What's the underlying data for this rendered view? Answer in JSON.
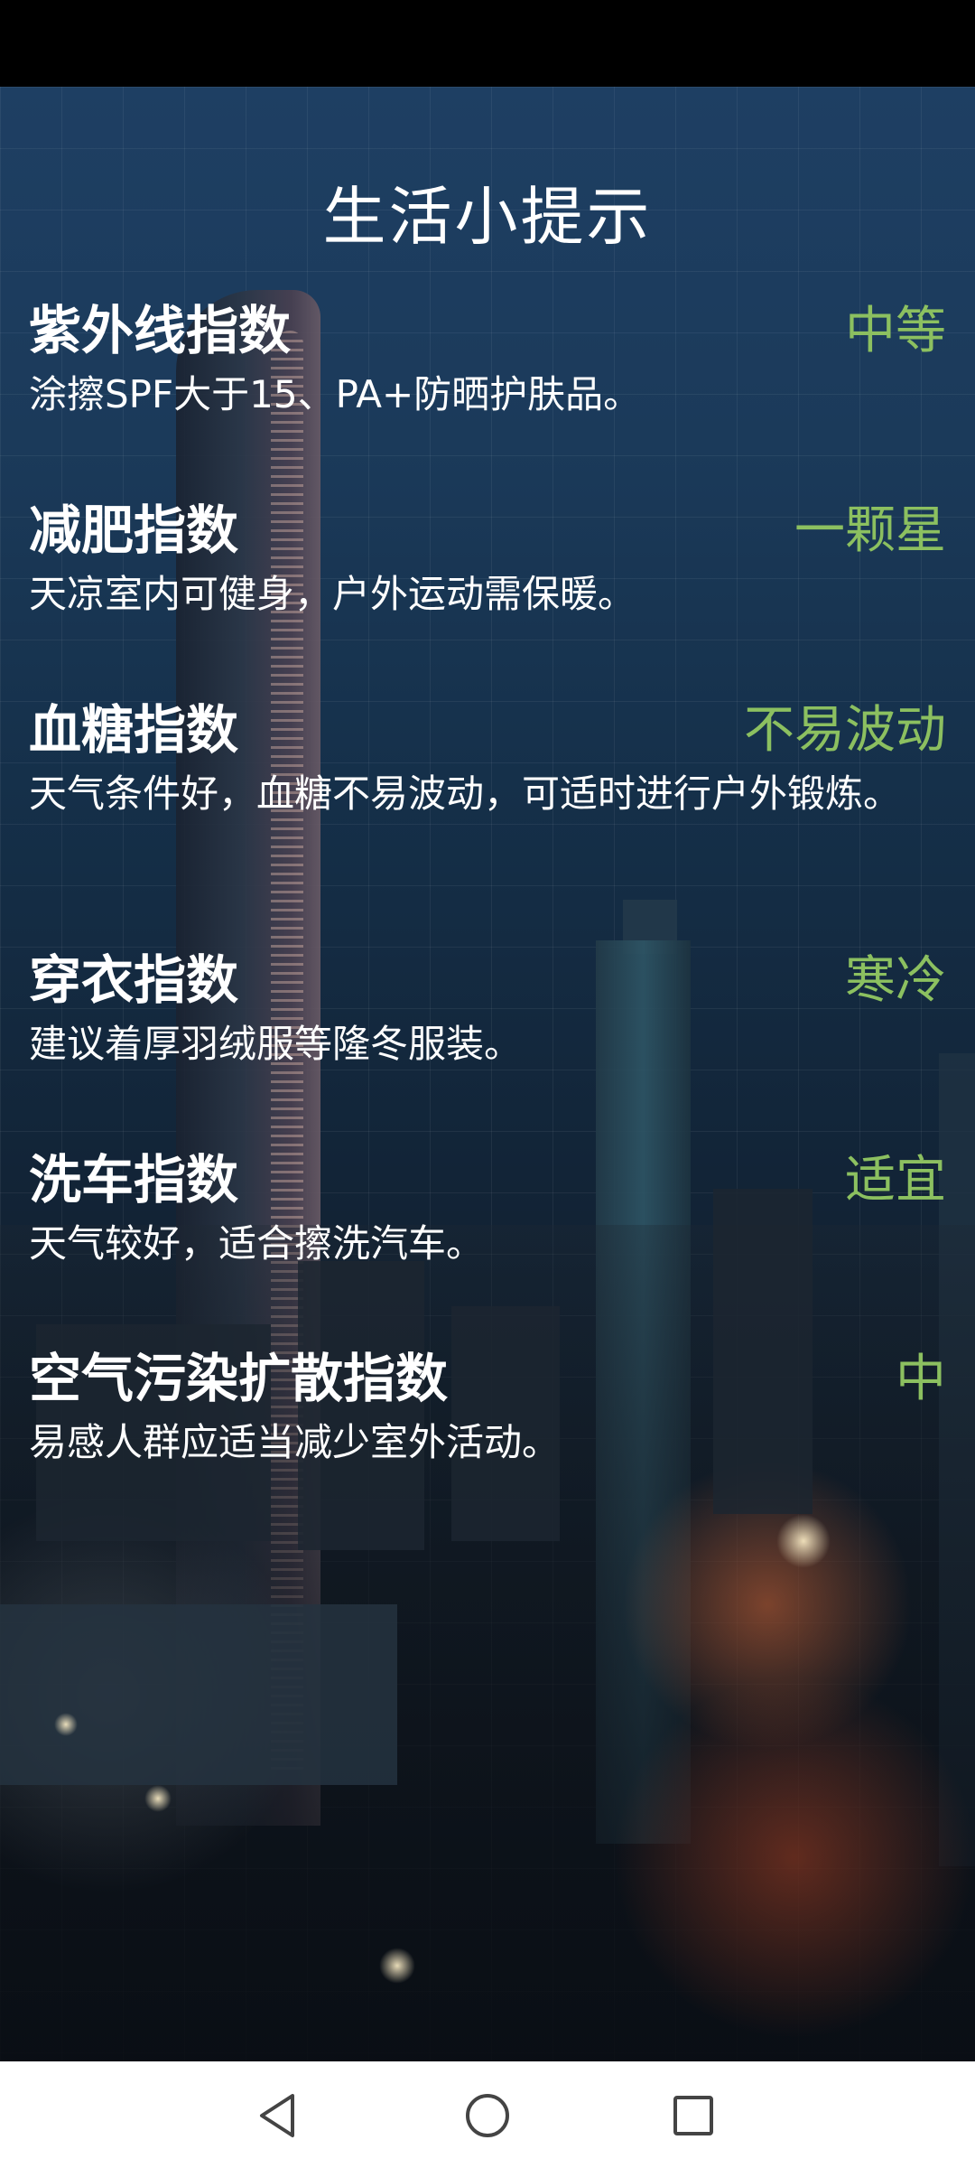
{
  "page": {
    "title": "生活小提示"
  },
  "tips": [
    {
      "name": "紫外线指数",
      "level": "中等",
      "desc": "涂擦SPF大于15、PA+防晒护肤品。"
    },
    {
      "name": "减肥指数",
      "level": "一颗星",
      "desc": "天凉室内可健身，户外运动需保暖。"
    },
    {
      "name": "血糖指数",
      "level": "不易波动",
      "desc": "天气条件好，血糖不易波动，可适时进行户外锻炼。"
    },
    {
      "name": "穿衣指数",
      "level": "寒冷",
      "desc": "建议着厚羽绒服等隆冬服装。"
    },
    {
      "name": "洗车指数",
      "level": "适宜",
      "desc": "天气较好，适合擦洗汽车。"
    },
    {
      "name": "空气污染扩散指数",
      "level": "中",
      "desc": "易感人群应适当减少室外活动。"
    }
  ],
  "colors": {
    "level_text": "#8cc060",
    "status_bar": "#000000",
    "nav_bar": "#ffffff"
  },
  "icons": {
    "back": "triangle-back-icon",
    "home": "circle-home-icon",
    "recents": "square-recents-icon"
  }
}
